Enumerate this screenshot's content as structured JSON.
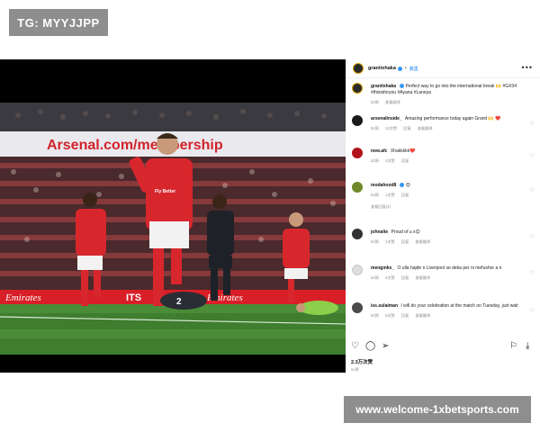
{
  "tg_badge": "TG: MYYJJPP",
  "website_badge": "www.welcome-1xbetsports.com",
  "photo": {
    "banner_text": "Arsenal.com/membership",
    "ad_board_left": "Emirates",
    "ad_board_mid": "ITS",
    "ad_board_right": "Emirates",
    "shirt_number_keeper": "2",
    "sponsor": "Fly Better"
  },
  "post": {
    "header": {
      "username": "granitxhaka",
      "follow_label": "关注",
      "more_label": "•••"
    },
    "comments": [
      {
        "username": "granitxhaka",
        "text": "Perfect way to go into the international break 🙌 #GX34 #thisisforyou #Ayana #Laneya",
        "meta": [
          "52周",
          "查看翻译"
        ],
        "avatar_color": "#2b2b2b"
      },
      {
        "username": "arsenalinside_",
        "text": "Amazing performance today again Granit 🙌 ❤️",
        "meta": [
          "52周",
          "13次赞",
          "回复",
          "查看翻译"
        ],
        "avatar_color": "#1a1a1a"
      },
      {
        "username": "now.afc",
        "text": "Xhakkkkk❤️",
        "meta": [
          "52周",
          "4次赞",
          "回复"
        ],
        "avatar_color": "#b3141b"
      },
      {
        "username": "modahood8",
        "text": "😍",
        "meta": [
          "52周",
          "1次赞",
          "回复"
        ],
        "avatar_color": "#6f8a2a"
      },
      {
        "username": "",
        "text": "",
        "meta": [
          "查看回复(3)"
        ],
        "avatar_color": ""
      },
      {
        "username": "johnalte",
        "text": "Proud of u x😊",
        "meta": [
          "52周",
          "1次赞",
          "回复",
          "查看翻译"
        ],
        "avatar_color": "#333333"
      },
      {
        "username": "mengmkx_",
        "text": "O ulla hajde n Liverpool se deka per ni mefushor a n",
        "meta": [
          "52周",
          "4次赞",
          "回复",
          "查看翻译"
        ],
        "avatar_color": "#dddddd"
      },
      {
        "username": "iss.sulaiman",
        "text": "I will do your celebration at the match on Tuesday, just wait",
        "meta": [
          "52周",
          "5次赞",
          "回复",
          "查看翻译"
        ],
        "avatar_color": "#4a4a4a"
      }
    ],
    "actions": {
      "like_icon": "heart-icon",
      "comment_icon": "comment-icon",
      "share_icon": "share-icon",
      "save_icon": "bookmark-icon",
      "download_icon": "download-icon"
    },
    "likes": "2.3万次赞",
    "time_ago": "52周"
  }
}
